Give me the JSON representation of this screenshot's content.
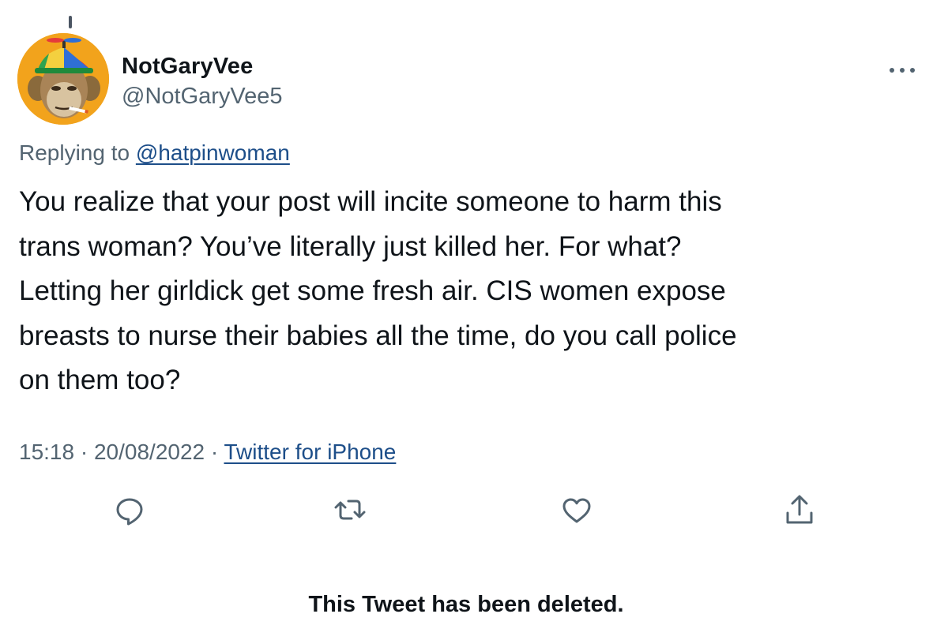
{
  "tweet": {
    "author": {
      "display_name": "NotGaryVee",
      "handle": "@NotGaryVee5",
      "avatar": "cartoon-ape-with-propeller-cap"
    },
    "more_icon": "ellipsis-icon",
    "replying_to": {
      "prefix": "Replying to",
      "handle": "@hatpinwoman"
    },
    "text_lines": [
      "You realize that your post will incite someone to harm this",
      "trans woman? You’ve literally just killed her. For what?",
      "Letting her girldick get some fresh air. CIS women expose",
      "breasts to nurse their babies all the time, do you call police",
      "on them too?"
    ],
    "meta": {
      "time": "15:18",
      "separator": "·",
      "date": "20/08/2022",
      "source": "Twitter for iPhone"
    },
    "actions": [
      {
        "name": "reply",
        "icon": "reply-icon"
      },
      {
        "name": "retweet",
        "icon": "retweet-icon"
      },
      {
        "name": "like",
        "icon": "heart-icon"
      },
      {
        "name": "share",
        "icon": "share-icon"
      }
    ]
  },
  "deleted_notice": "This Tweet has been deleted.",
  "colors": {
    "text_primary": "#0f1419",
    "text_secondary": "#536471",
    "link": "#1d4e89",
    "avatar_background": "#f2a31c"
  }
}
